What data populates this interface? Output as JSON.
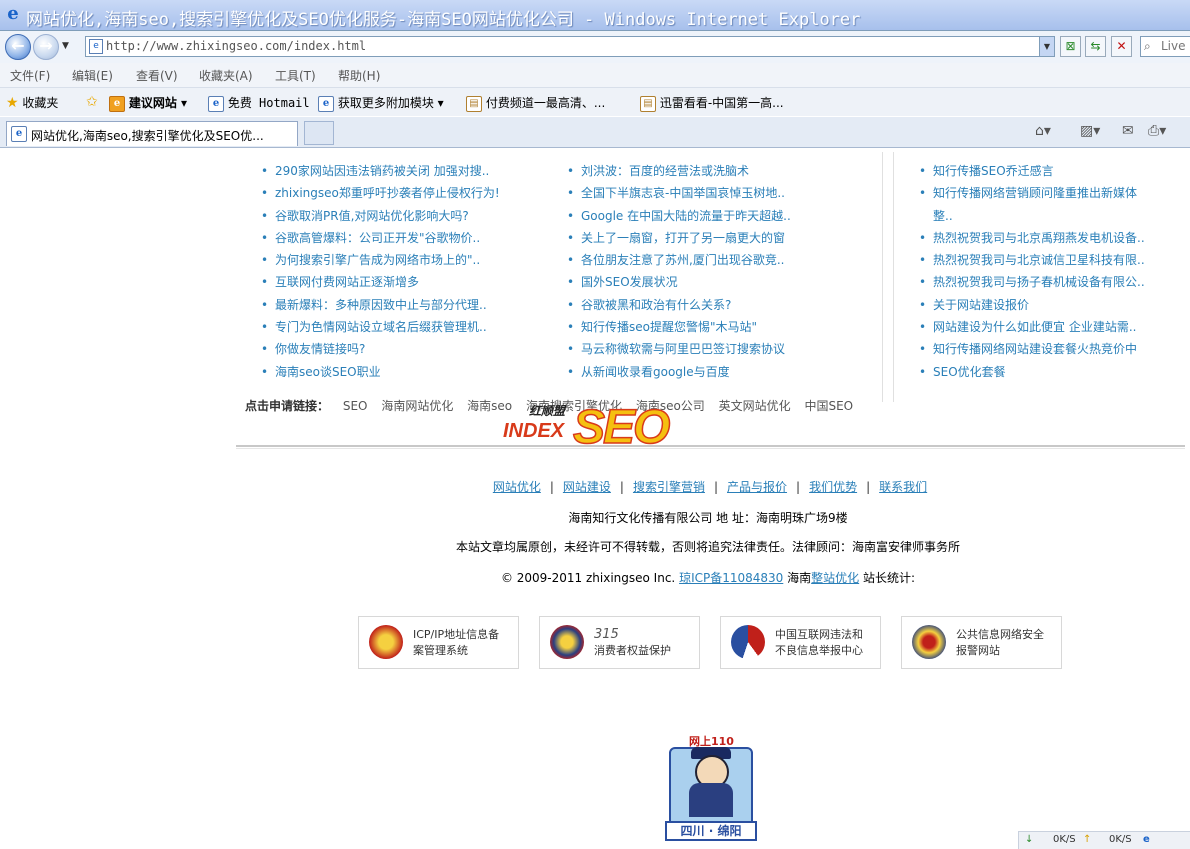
{
  "window": {
    "title": "网站优化,海南seo,搜索引擎优化及SEO优化服务-海南SEO网站优化公司 - Windows Internet Explorer"
  },
  "address": {
    "url": "http://www.zhixingseo.com/index.html",
    "search_placeholder": "Live"
  },
  "menu": [
    "文件(F)",
    "编辑(E)",
    "查看(V)",
    "收藏夹(A)",
    "工具(T)",
    "帮助(H)"
  ],
  "favorites": {
    "label": "收藏夹",
    "items": [
      "建议网站 ▾",
      "免费 Hotmail",
      "获取更多附加模块 ▾",
      "付费频道一最高清、...",
      "迅雷看看-中国第一高..."
    ]
  },
  "tab": {
    "title": "网站优化,海南seo,搜索引擎优化及SEO优..."
  },
  "news": {
    "col1": [
      "290家网站因违法销药被关闭 加强对搜..",
      "zhixingseo郑重呼吁抄袭者停止侵权行为!",
      "谷歌取消PR值,对网站优化影响大吗?",
      "谷歌高管爆料：公司正开发\"谷歌物价..",
      "为何搜索引擎广告成为网络市场上的\"..",
      "互联网付费网站正逐渐增多",
      "最新爆料：多种原因致中止与部分代理..",
      "专门为色情网站设立域名后缀获管理机..",
      "你做友情链接吗?",
      "海南seo谈SEO职业"
    ],
    "col2": [
      "刘洪波：百度的经营法或洗脑术",
      "全国下半旗志哀-中国举国哀悼玉树地..",
      "Google 在中国大陆的流量于昨天超越..",
      "关上了一扇窗，打开了另一扇更大的窗",
      "各位朋友注意了苏州,厦门出现谷歌竞..",
      "国外SEO发展状况",
      "谷歌被黑和政治有什么关系?",
      "知行传播seo提醒您警惕\"木马站\"",
      "马云称微软需与阿里巴巴签订搜索协议",
      "从新闻收录看google与百度"
    ],
    "col3": [
      "知行传播SEO乔迁感言",
      "知行传播网络营销顾问隆重推出新媒体",
      "整..",
      "热烈祝贺我司与北京禹翔燕发电机设备..",
      "热烈祝贺我司与北京诚信卫星科技有限..",
      "热烈祝贺我司与扬子春机械设备有限公..",
      "关于网站建设报价",
      "网站建设为什么如此便宜 企业建站需..",
      "知行传播网络网站建设套餐火热竞价中",
      "SEO优化套餐"
    ]
  },
  "friend_links": {
    "label": "点击申请链接：",
    "items": [
      "SEO",
      "海南网站优化",
      "海南seo",
      "海南搜索引擎优化",
      "海南seo公司",
      "英文网站优化",
      "中国SEO"
    ]
  },
  "logo": {
    "small": "红顺盟",
    "index": "INDEX",
    "seo": "SEO"
  },
  "footer": {
    "nav": [
      "网站优化",
      "网站建设",
      "搜索引擎营销",
      "产品与报价",
      "我们优势",
      "联系我们"
    ],
    "company": "海南知行文化传播有限公司 地 址：海南明珠广场9楼",
    "notice": "本站文章均属原创，未经许可不得转载，否则将追究法律责任。法律顾问：海南富安律师事务所",
    "copyright_prefix": "© 2009-2011 zhixingseo Inc.",
    "icp": "琼ICP备11084830",
    "copyright_mid": "海南",
    "link2": "整站优化",
    "copyright_suffix": "站长统计:",
    "badges": [
      {
        "l1": "ICP/IP地址信息备",
        "l2": "案管理系统"
      },
      {
        "l1": "315",
        "l2": "消费者权益保护"
      },
      {
        "l1": "中国互联网违法和",
        "l2": "不良信息举报中心"
      },
      {
        "l1": "公共信息网络安全",
        "l2": "报警网站"
      }
    ],
    "cop_head": "网上110",
    "cop_foot": "四川 · 绵阳"
  },
  "statusbar": {
    "down": "0K/S",
    "up": "0K/S"
  }
}
